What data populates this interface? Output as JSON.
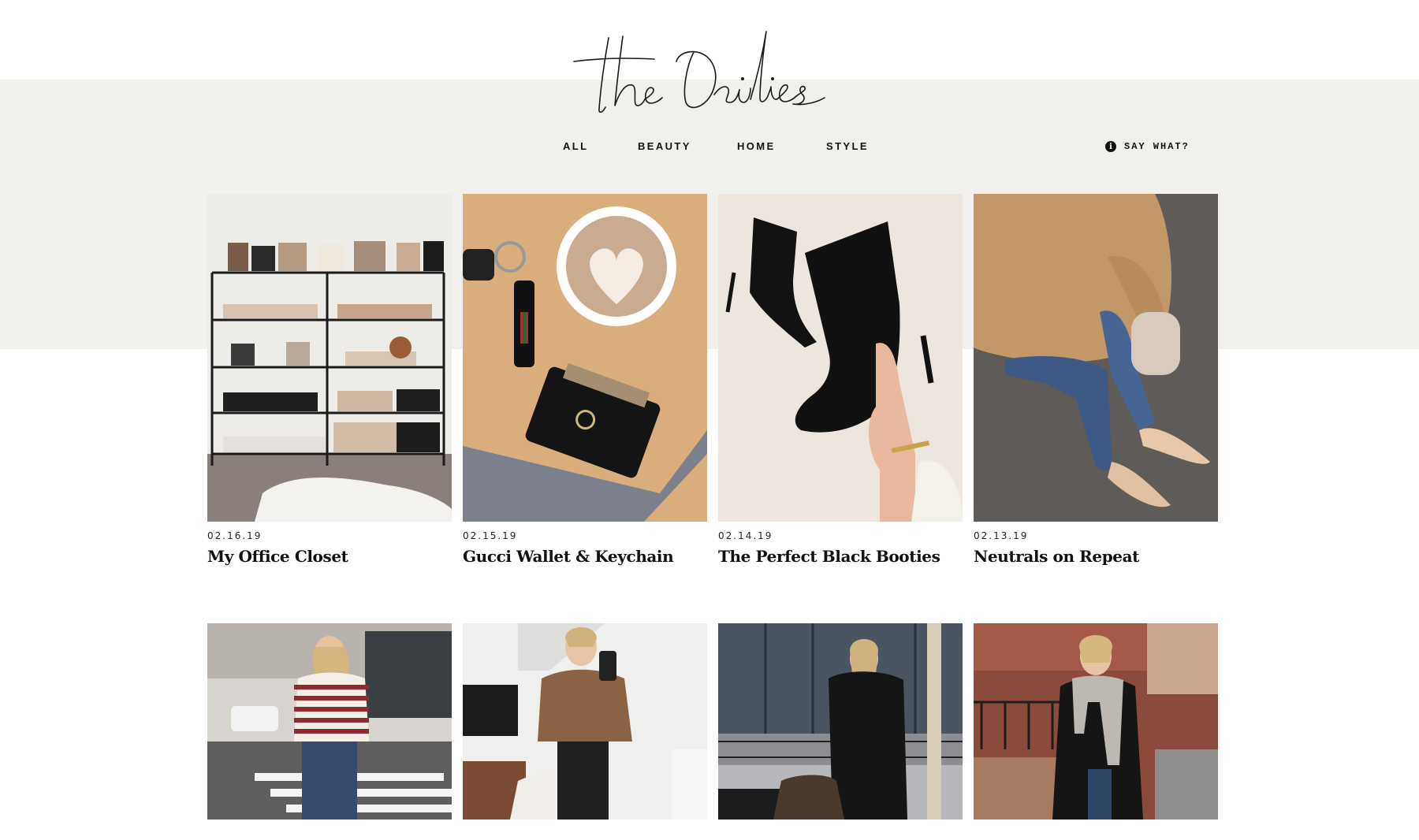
{
  "site": {
    "logo_text": "the Dailies"
  },
  "nav": {
    "items": [
      {
        "label": "ALL"
      },
      {
        "label": "BEAUTY"
      },
      {
        "label": "HOME"
      },
      {
        "label": "STYLE"
      }
    ],
    "say_what": {
      "label": "SAY WHAT?",
      "icon": "info-icon"
    }
  },
  "posts": [
    {
      "date": "02.16.19",
      "title": "My Office Closet",
      "image": "office closet shelves"
    },
    {
      "date": "02.15.19",
      "title": "Gucci Wallet & Keychain",
      "image": "latte and wallet"
    },
    {
      "date": "02.14.19",
      "title": "The Perfect Black Booties",
      "image": "black booties"
    },
    {
      "date": "02.13.19",
      "title": "Neutrals on Repeat",
      "image": "camel sweater outfit"
    },
    {
      "image": "striped sweater street"
    },
    {
      "image": "brown sweater mirror selfie"
    },
    {
      "image": "black puffer coat"
    },
    {
      "image": "grey scarf brownstone"
    }
  ],
  "colors": {
    "band": "#f1f0ec",
    "text": "#111111"
  }
}
